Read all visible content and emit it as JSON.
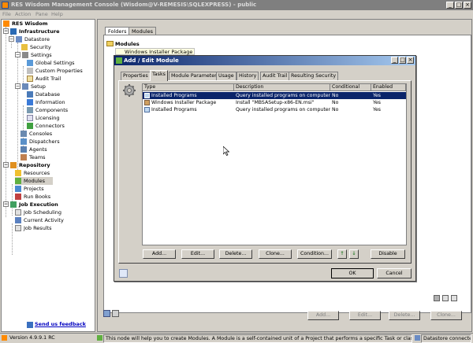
{
  "window": {
    "title": "RES Wisdom Management Console (Wisdom@V-REMESIS\\SQLEXPRESS) - public"
  },
  "menu": [
    "File",
    "Action",
    "Pane",
    "Help"
  ],
  "tree": {
    "root": "RES Wisdom",
    "infrastructure": "Infrastructure",
    "datastore": "Datastore",
    "security": "Security",
    "settings": "Settings",
    "global_settings": "Global Settings",
    "custom_properties": "Custom Properties",
    "audit_trail": "Audit Trail",
    "setup": "Setup",
    "database": "Database",
    "information": "Information",
    "components": "Components",
    "licensing": "Licensing",
    "connectors": "Connectors",
    "consoles": "Consoles",
    "dispatchers": "Dispatchers",
    "agents": "Agents",
    "teams": "Teams",
    "repository": "Repository",
    "resources": "Resources",
    "modules": "Modules",
    "projects": "Projects",
    "run_books": "Run Books",
    "job_execution": "Job Execution",
    "job_scheduling": "Job Scheduling",
    "current_activity": "Current Activity",
    "job_results": "Job Results"
  },
  "feedback": "Send us feedback",
  "main_tabs": [
    "Folders",
    "Modules"
  ],
  "modules_label": "Modules",
  "selected_module": "Windows Installer Package",
  "dialog": {
    "title": "Add / Edit Module",
    "tabs": [
      "Properties",
      "Tasks",
      "Module Parameters",
      "Usage",
      "History",
      "Audit Trail",
      "Resulting Security"
    ],
    "columns": [
      "Type",
      "Description",
      "Conditional",
      "Enabled"
    ],
    "rows": [
      {
        "type": "Installed Programs",
        "description": "Query installed programs on computer",
        "conditional": "No",
        "enabled": "Yes"
      },
      {
        "type": "Windows Installer Package",
        "description": "Install \"MBSASetup-x86-EN.msi\"",
        "conditional": "No",
        "enabled": "Yes"
      },
      {
        "type": "Installed Programs",
        "description": "Query installed programs on computer",
        "conditional": "No",
        "enabled": "Yes"
      }
    ],
    "buttons": {
      "add": "Add...",
      "edit": "Edit...",
      "delete": "Delete...",
      "clone": "Clone...",
      "condition": "Condition...",
      "up": "↑",
      "down": "↓",
      "disable": "Disable",
      "ok": "OK",
      "cancel": "Cancel"
    }
  },
  "panel_buttons": {
    "add": "Add...",
    "edit": "Edit...",
    "delete": "Delete...",
    "clone": "Clone..."
  },
  "status": {
    "version": "Version 4.9.9.1 RC",
    "message": "This node will help you to create Modules. A Module is a self-contained unit of a Project that performs a specific Task or class of Tasks in",
    "datastore": "Datastore connected"
  },
  "colors": {
    "selection": "#0a246a",
    "dialog_title_start": "#0a246a",
    "dialog_title_end": "#a6caf0"
  }
}
